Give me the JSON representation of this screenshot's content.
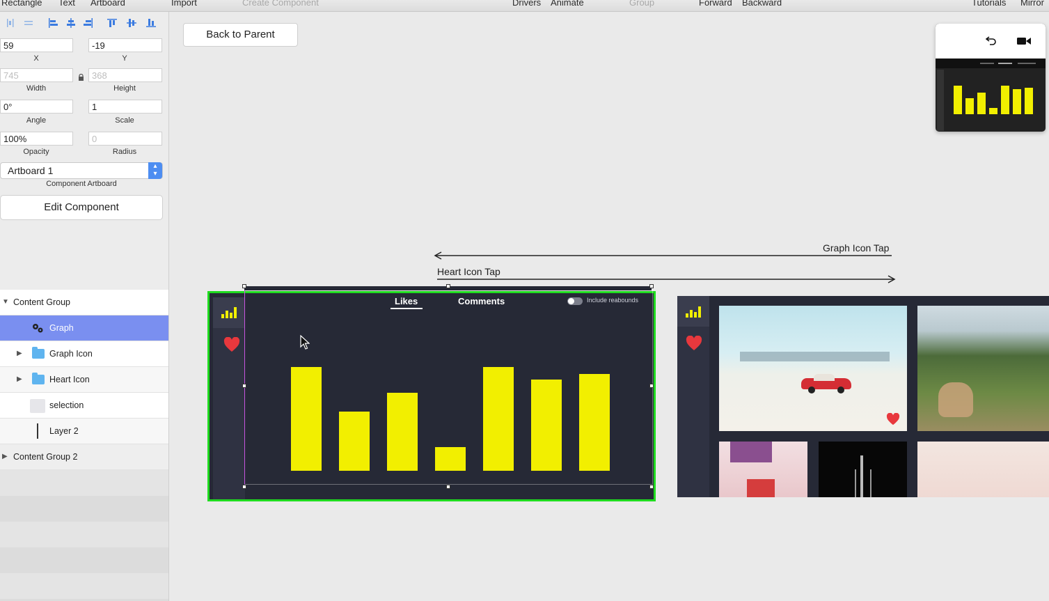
{
  "toolbar": {
    "rectangle": "Rectangle",
    "text": "Text",
    "artboard": "Artboard",
    "import": "Import",
    "create_component": "Create Component",
    "drivers": "Drivers",
    "animate": "Animate",
    "group": "Group",
    "forward": "Forward",
    "backward": "Backward",
    "tutorials": "Tutorials",
    "mirror": "Mirror"
  },
  "inspector": {
    "x": {
      "value": "59",
      "label": "X"
    },
    "y": {
      "value": "-19",
      "label": "Y"
    },
    "width": {
      "value": "745",
      "label": "Width"
    },
    "height": {
      "value": "368",
      "label": "Height"
    },
    "angle": {
      "value": "0°",
      "label": "Angle"
    },
    "scale": {
      "value": "1",
      "label": "Scale"
    },
    "opacity": {
      "value": "100%",
      "label": "Opacity"
    },
    "radius": {
      "value": "0",
      "label": "Radius"
    },
    "component_artboard": {
      "value": "Artboard 1",
      "label": "Component Artboard"
    },
    "edit_component": "Edit Component"
  },
  "layers": [
    {
      "name": "Content Group",
      "expanded": true
    },
    {
      "name": "Graph",
      "selected": true
    },
    {
      "name": "Graph Icon"
    },
    {
      "name": "Heart Icon"
    },
    {
      "name": "selection"
    },
    {
      "name": "Layer 2"
    },
    {
      "name": "Content Group 2",
      "expanded": false
    }
  ],
  "canvas": {
    "back_to_parent": "Back to Parent",
    "graph_icon_tap": "Graph Icon Tap",
    "heart_icon_tap": "Heart Icon Tap",
    "tabs": {
      "likes": "Likes",
      "comments": "Comments"
    },
    "toggle_label": "Include reabounds"
  },
  "graph": {
    "bar_levels": [
      0.93,
      0.53,
      0.7,
      0.21,
      0.93,
      0.82,
      0.87
    ]
  },
  "colors": {
    "accent_green": "#1fdb1f",
    "bar_yellow": "#f2ef00",
    "panel_dark": "#262936",
    "heart_red": "#e8383d",
    "selection_blue": "#7a8ff0"
  }
}
